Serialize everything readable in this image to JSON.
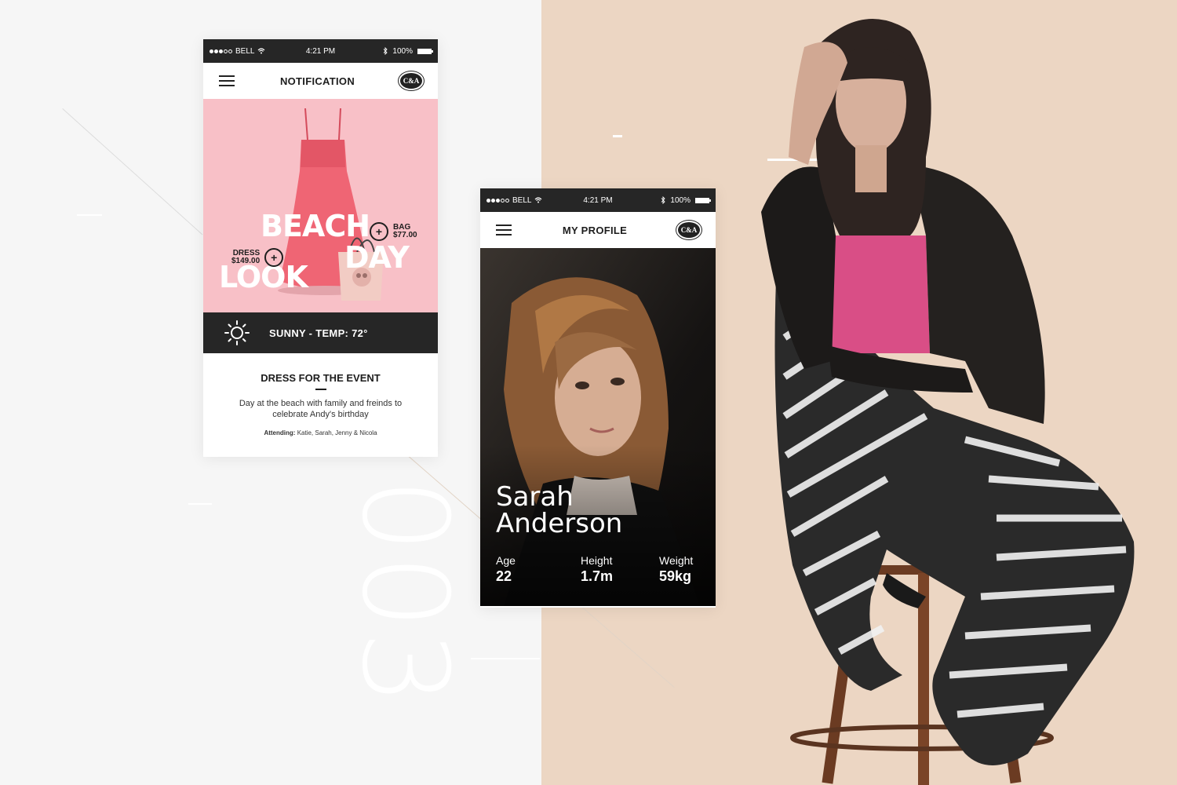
{
  "decor": {
    "big_number": "003"
  },
  "colors": {
    "left_bg": "#f6f6f6",
    "right_bg": "#ecd6c3",
    "promo_pink": "#f8c0c7",
    "dark": "#262626"
  },
  "notification_screen": {
    "status": {
      "carrier": "BELL",
      "time": "4:21 PM",
      "battery": "100%",
      "signal_icon": "signal-dots-icon",
      "wifi_icon": "wifi-icon",
      "bluetooth_icon": "bluetooth-icon",
      "battery_level": 1.0
    },
    "nav": {
      "title": "NOTIFICATION",
      "logo": "C&A"
    },
    "promo": {
      "line1": "BEACH",
      "line2": "DAY",
      "line3": "LOOK",
      "dress_label": "DRESS",
      "dress_price": "$149.00",
      "bag_label": "BAG",
      "bag_price": "$77.00"
    },
    "weather": {
      "text": "SUNNY - TEMP: 72°",
      "icon": "sun-icon"
    },
    "event": {
      "title": "DRESS FOR THE EVENT",
      "description": "Day at the beach with family and freinds to celebrate Andy's birthday",
      "attending_label": "Attending:",
      "attending_names": "Katie,  Sarah,  Jenny & Nicola"
    }
  },
  "profile_screen": {
    "status": {
      "carrier": "BELL",
      "time": "4:21 PM",
      "battery": "100%",
      "battery_level": 1.0
    },
    "nav": {
      "title": "MY PROFILE",
      "logo": "C&A"
    },
    "profile": {
      "first_name": "Sarah",
      "last_name": "Anderson",
      "age_label": "Age",
      "age_value": "22",
      "height_label": "Height",
      "height_value": "1.7m",
      "weight_label": "Weight",
      "weight_value": "59kg"
    }
  }
}
